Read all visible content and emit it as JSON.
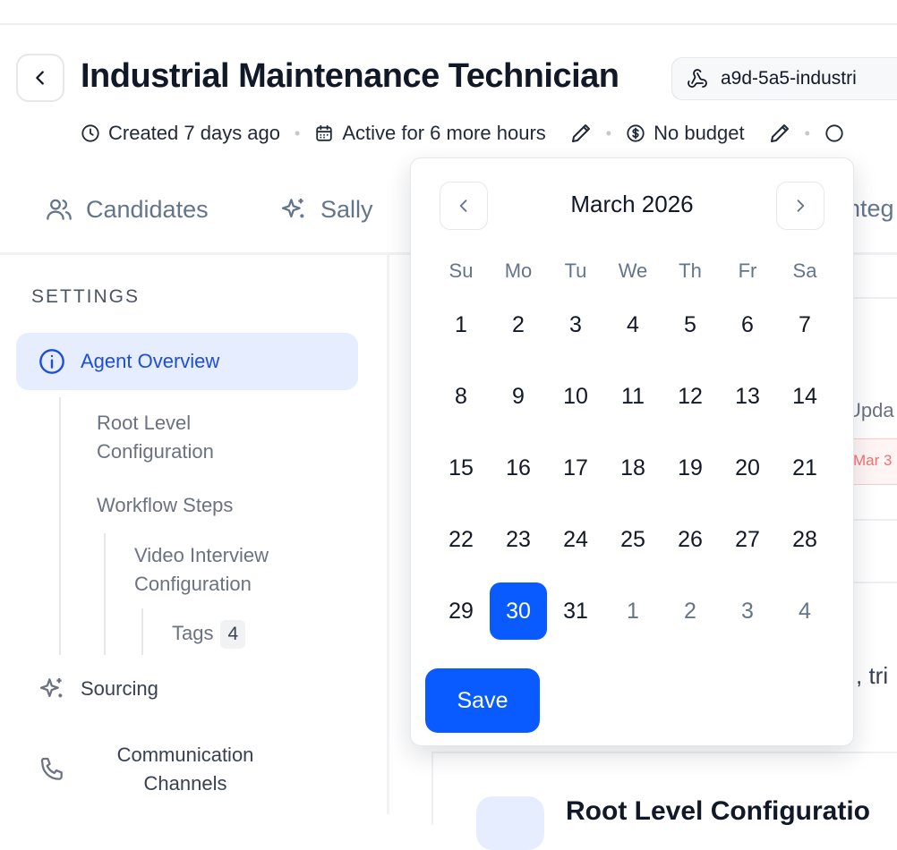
{
  "header": {
    "title": "Industrial Maintenance Technician",
    "agent_id": "a9d-5a5-industri",
    "meta": {
      "created": "Created 7 days ago",
      "active": "Active for 6 more hours",
      "budget": "No budget"
    }
  },
  "tabs": [
    {
      "label": "Candidates",
      "icon": "users-icon"
    },
    {
      "label": "Sally",
      "icon": "sparkles-icon"
    },
    {
      "label": "nteg",
      "icon": "none"
    }
  ],
  "sidebar": {
    "section_label": "SETTINGS",
    "active_item": "Agent Overview",
    "sub_items": [
      "Root Level Configuration",
      "Workflow Steps",
      "Video Interview Configuration"
    ],
    "tags": {
      "label": "Tags",
      "count": "4"
    },
    "items": [
      "Sourcing",
      "Communication Channels"
    ]
  },
  "content_peek": {
    "updated": "Upda",
    "date_chip": "Mar 3",
    "text": ", tri",
    "heading": "Root Level Configuratio"
  },
  "calendar": {
    "month_label": "March 2026",
    "weekdays": [
      "Su",
      "Mo",
      "Tu",
      "We",
      "Th",
      "Fr",
      "Sa"
    ],
    "weeks": [
      [
        "1",
        "2",
        "3",
        "4",
        "5",
        "6",
        "7"
      ],
      [
        "8",
        "9",
        "10",
        "11",
        "12",
        "13",
        "14"
      ],
      [
        "15",
        "16",
        "17",
        "18",
        "19",
        "20",
        "21"
      ],
      [
        "22",
        "23",
        "24",
        "25",
        "26",
        "27",
        "28"
      ],
      [
        "29",
        "30",
        "31",
        "1",
        "2",
        "3",
        "4"
      ]
    ],
    "selected_day": "30",
    "save_label": "Save"
  },
  "colors": {
    "accent": "#0a5bff",
    "active_bg": "#e6edff",
    "muted": "#64748b"
  }
}
